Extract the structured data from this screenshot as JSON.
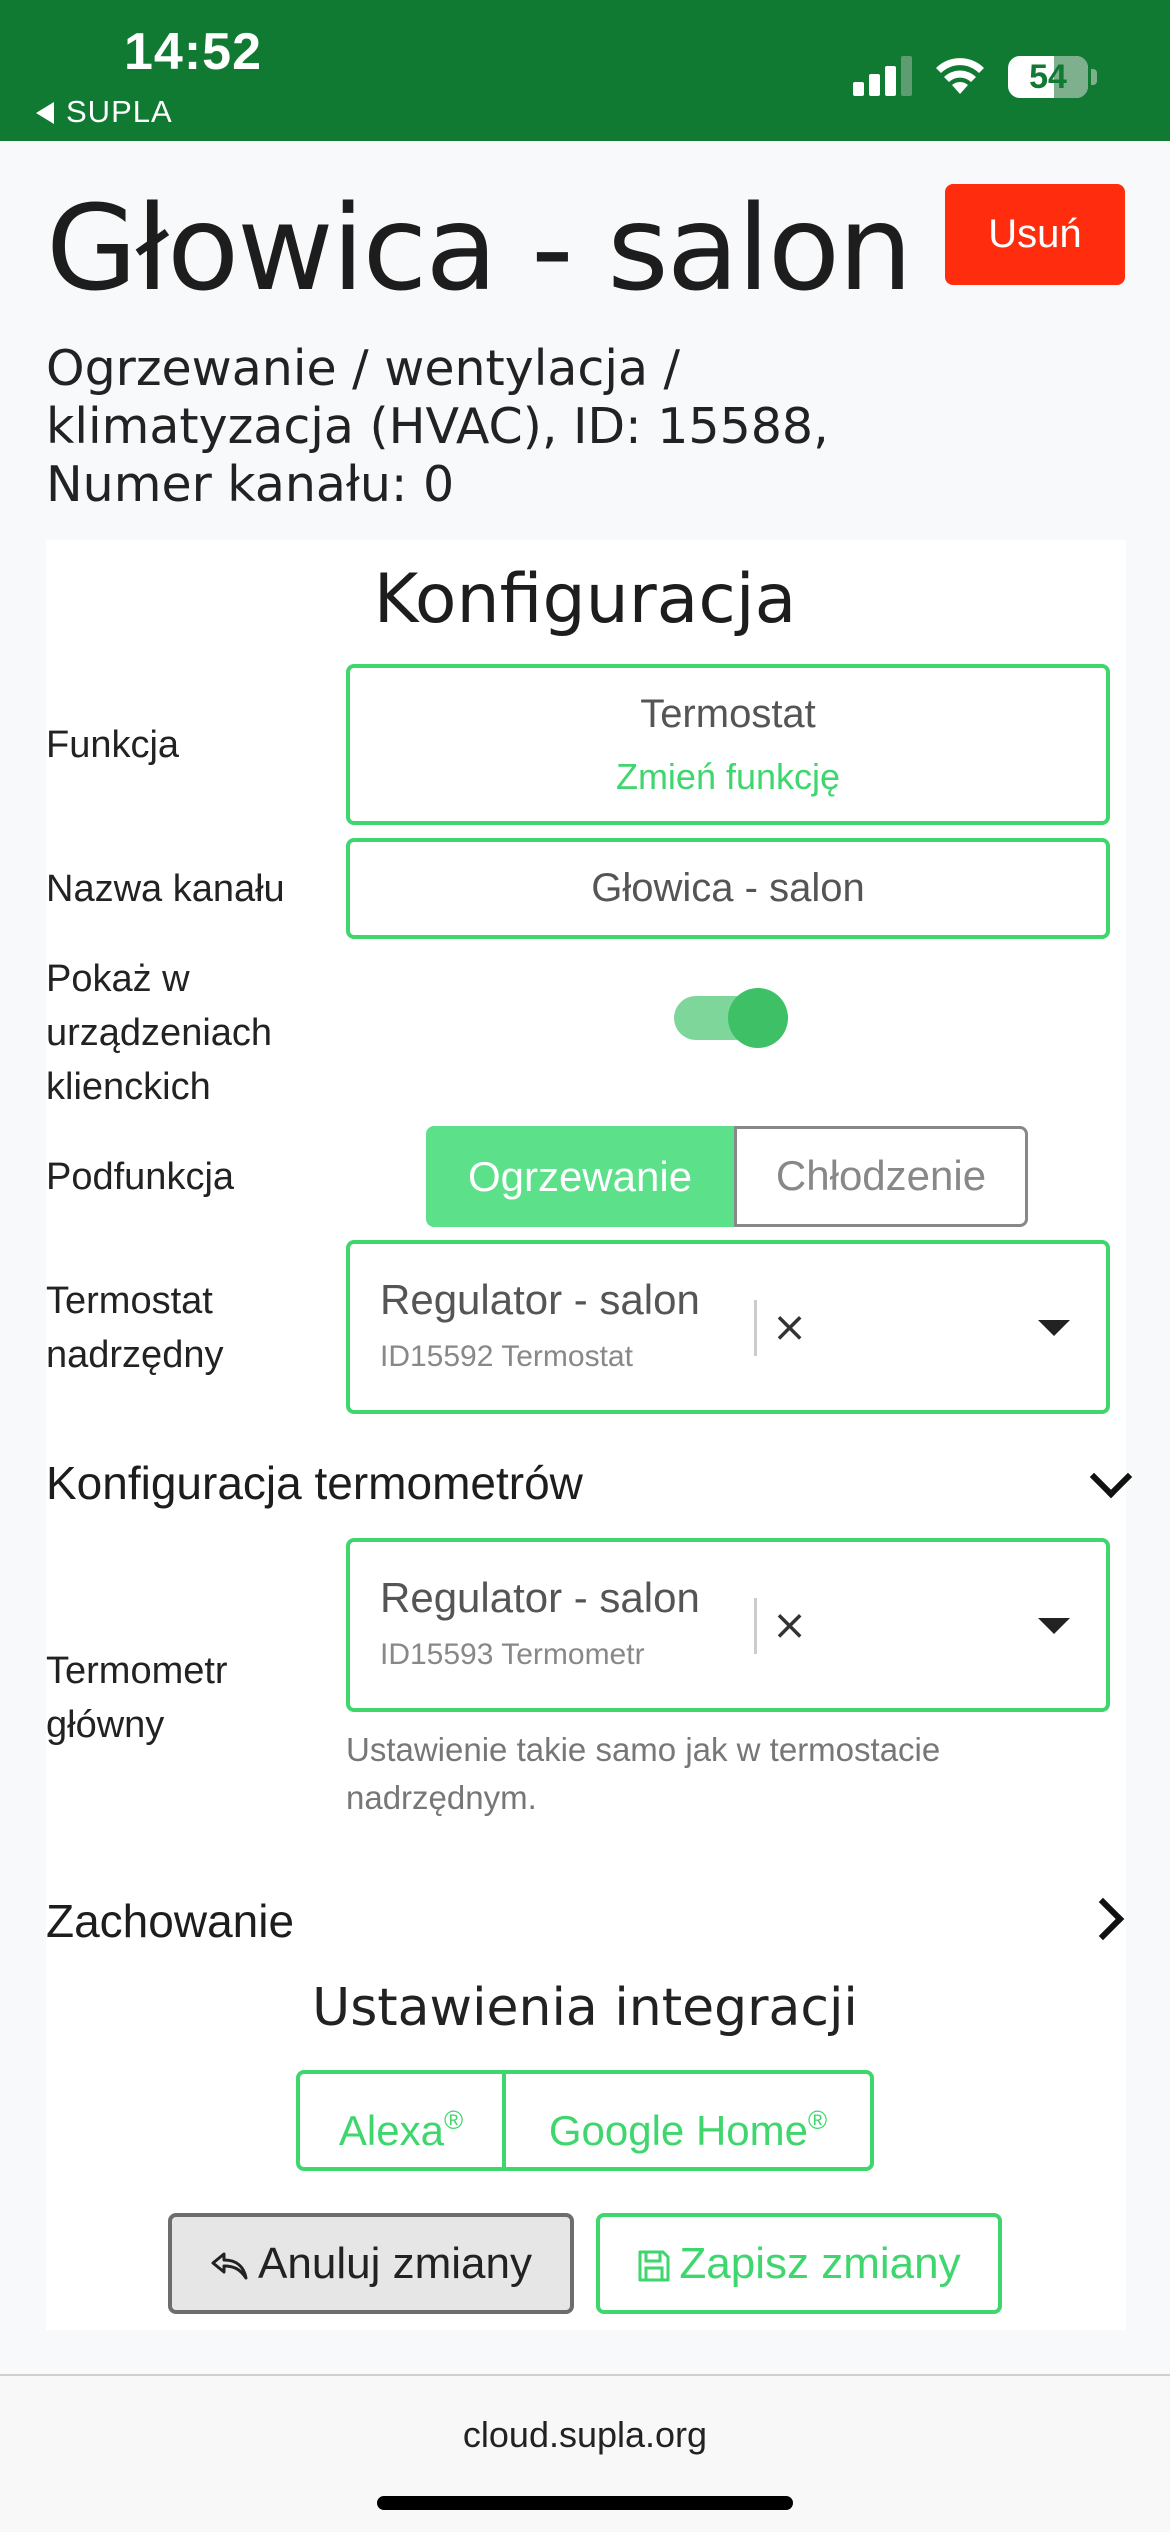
{
  "status_bar": {
    "time": "14:52",
    "back_app": "SUPLA",
    "battery": "54"
  },
  "header": {
    "title": "Głowica - salon",
    "delete_label": "Usuń",
    "subtitle": "Ogrzewanie / wentylacja / klimatyzacja (HVAC), ID: 15588, Numer kanału: 0"
  },
  "config": {
    "title": "Konfiguracja",
    "function_label": "Funkcja",
    "function_value": "Termostat",
    "change_function": "Zmień funkcję",
    "channel_name_label": "Nazwa kanału",
    "channel_name_value": "Głowica - salon",
    "show_in_clients_label": "Pokaż w urządzeniach klienckich",
    "show_in_clients_on": true,
    "subfunction_label": "Podfunkcja",
    "subfunction_options": [
      "Ogrzewanie",
      "Chłodzenie"
    ],
    "subfunction_selected": "Ogrzewanie",
    "master_thermostat_label": "Termostat nadrzędny",
    "master_thermostat": {
      "name": "Regulator - salon",
      "desc": "ID15592 Termostat",
      "clear": "×"
    },
    "thermometers_section": "Konfiguracja termometrów",
    "main_thermometer_label": "Termometr główny",
    "main_thermometer": {
      "name": "Regulator - salon",
      "desc": "ID15593 Termometr",
      "clear": "×"
    },
    "main_thermometer_hint": "Ustawienie takie samo jak w termostacie nadrzędnym.",
    "behavior_section": "Zachowanie",
    "integrations_title": "Ustawienia integracji",
    "integrations": [
      {
        "label": "Alexa",
        "mark": "®"
      },
      {
        "label": "Google Home",
        "mark": "®"
      }
    ],
    "cancel_label": "Anuluj zmiany",
    "save_label": "Zapisz zmiany"
  },
  "browser": {
    "url": "cloud.supla.org"
  },
  "colors": {
    "status_bar": "#117a32",
    "accent_green": "#3ed66d",
    "delete_red": "#ff2d0e"
  }
}
